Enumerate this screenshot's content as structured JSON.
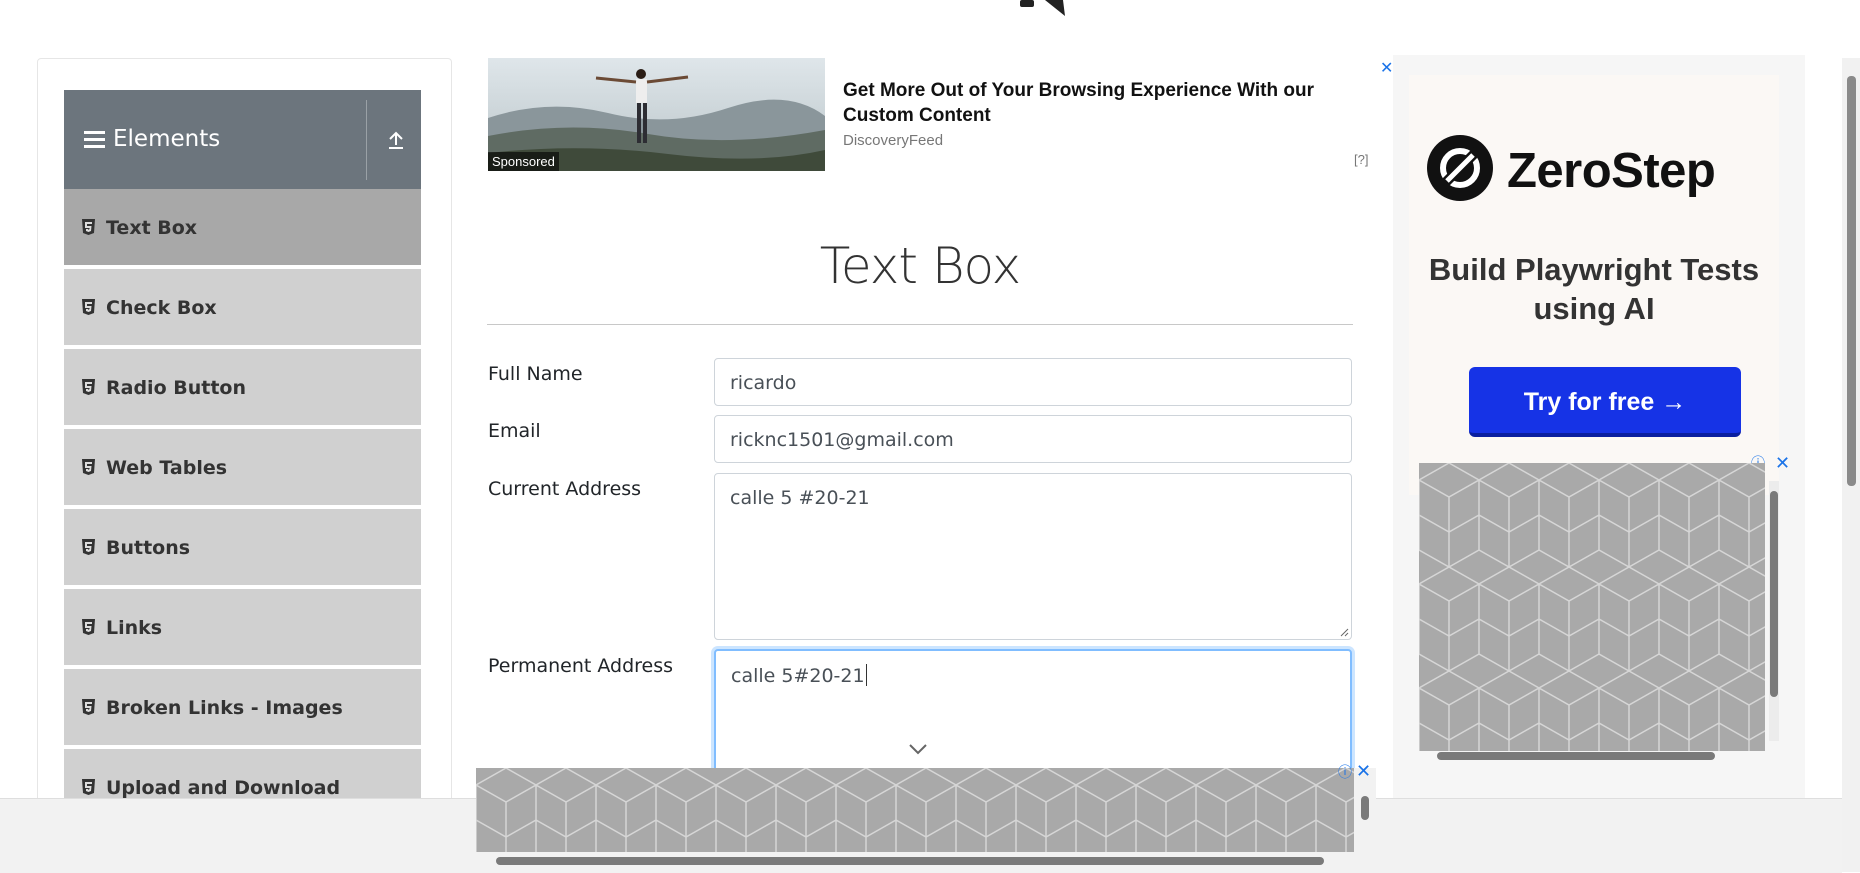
{
  "sidebar": {
    "group_title": "Elements",
    "items": [
      {
        "label": "Text Box"
      },
      {
        "label": "Check Box"
      },
      {
        "label": "Radio Button"
      },
      {
        "label": "Web Tables"
      },
      {
        "label": "Buttons"
      },
      {
        "label": "Links"
      },
      {
        "label": "Broken Links - Images"
      },
      {
        "label": "Upload and Download"
      }
    ],
    "active_index": 0
  },
  "ad_top": {
    "badge": "Sponsored",
    "headline": "Get More Out of Your Browsing Experience With our Custom Content",
    "source": "DiscoveryFeed",
    "help": "[?]",
    "close": "✕"
  },
  "main": {
    "title": "Text Box",
    "form": {
      "full_name_label": "Full Name",
      "full_name_value": "ricardo",
      "email_label": "Email",
      "email_value": "ricknc1501@gmail.com",
      "current_address_label": "Current Address",
      "current_address_value": "calle 5 #20-21",
      "permanent_address_label": "Permanent Address",
      "permanent_address_value": "calle 5#20-21"
    }
  },
  "ad_right": {
    "brand": "ZeroStep",
    "tagline": "Build Playwright Tests using AI",
    "cta": "Try for free →",
    "close": "✕",
    "info": "ⓘ"
  },
  "ad_bottom": {
    "close": "✕",
    "info": "ⓘ"
  },
  "colors": {
    "sidebar_header": "#6c757d",
    "sidebar_item": "#d0d0d0",
    "sidebar_item_active": "#a8a8a8",
    "cta_blue": "#1633e6",
    "focus_border": "#80bdff"
  }
}
